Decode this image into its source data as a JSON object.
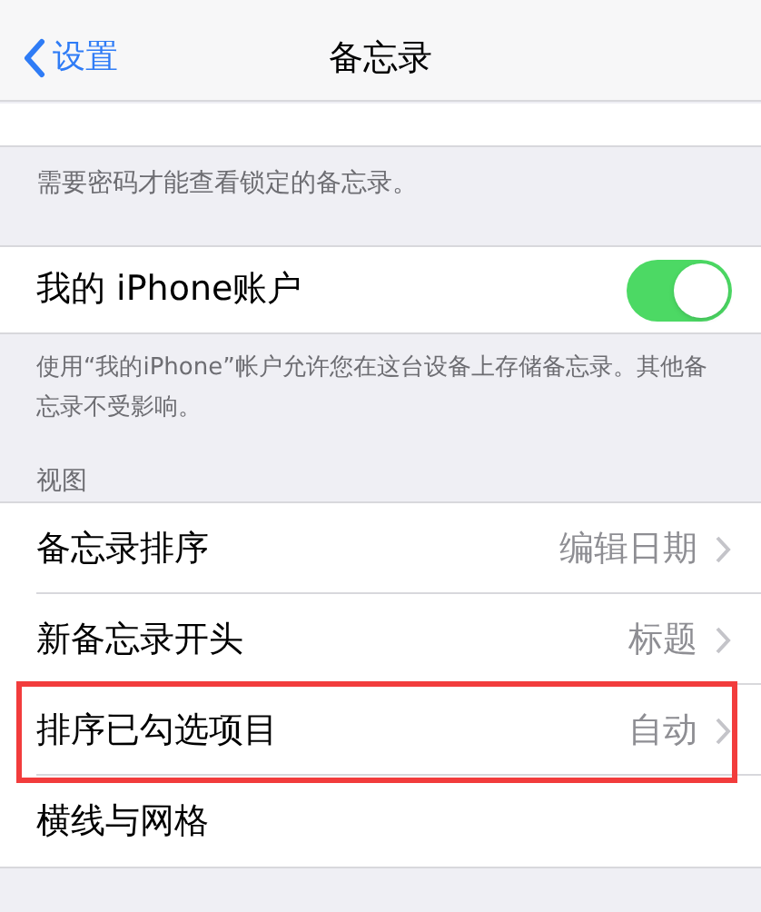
{
  "nav": {
    "back": "设置",
    "title": "备忘录"
  },
  "password_footer": "需要密码才能查看锁定的备忘录。",
  "account_row": {
    "label": "我的 iPhone账户",
    "on": true
  },
  "account_footer": "使用“我的iPhone”帐户允许您在这台设备上存储备忘录。其他备忘录不受影响。",
  "view_section": {
    "header": "视图",
    "rows": [
      {
        "label": "备忘录排序",
        "value": "编辑日期",
        "highlighted": false
      },
      {
        "label": "新备忘录开头",
        "value": "标题",
        "highlighted": false
      },
      {
        "label": "排序已勾选项目",
        "value": "自动",
        "highlighted": true
      },
      {
        "label": "横线与网格",
        "highlighted": false
      }
    ]
  }
}
